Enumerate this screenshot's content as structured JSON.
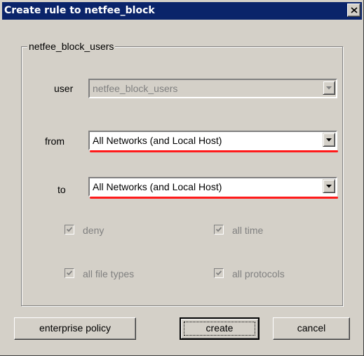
{
  "window": {
    "title": "Create rule to netfee_block",
    "close_label": "X"
  },
  "group": {
    "legend": "netfee_block_users"
  },
  "fields": {
    "user": {
      "label": "user",
      "value": "netfee_block_users",
      "enabled": false
    },
    "from": {
      "label": "from",
      "value": "All Networks (and Local Host)",
      "enabled": true
    },
    "to": {
      "label": "to",
      "value": "All Networks (and Local Host)",
      "enabled": true
    }
  },
  "checkboxes": {
    "deny": {
      "label": "deny",
      "checked": true,
      "enabled": false
    },
    "all_time": {
      "label": "all time",
      "checked": true,
      "enabled": false
    },
    "all_file_types": {
      "label": "all file types",
      "checked": true,
      "enabled": false
    },
    "all_protocols": {
      "label": "all protocols",
      "checked": true,
      "enabled": false
    }
  },
  "buttons": {
    "enterprise_policy": "enterprise policy",
    "create": "create",
    "cancel": "cancel"
  },
  "colors": {
    "titlebar": "#0a246a",
    "dialog_bg": "#d4d0c8",
    "highlight_underline": "#ff1a1a"
  }
}
